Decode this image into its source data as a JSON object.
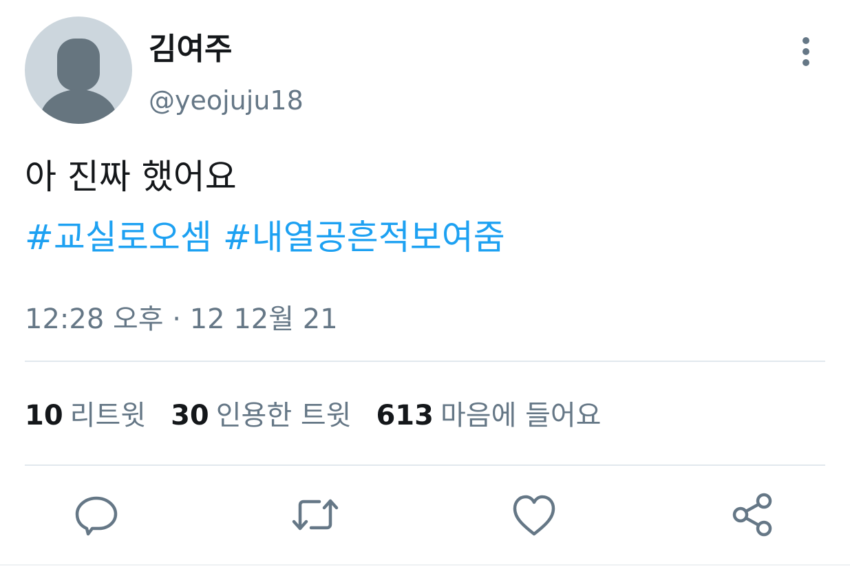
{
  "user": {
    "display_name": "김여주",
    "handle": "@yeojuju18"
  },
  "tweet": {
    "text": "아 진짜 했어요",
    "hashtags": [
      "#교실로오셈",
      "#내열공흔적보여줌"
    ],
    "timestamp": "12:28 오후 · 12 12월 21"
  },
  "stats": [
    {
      "count": "10",
      "label": "리트윗"
    },
    {
      "count": "30",
      "label": "인용한 트윗"
    },
    {
      "count": "613",
      "label": "마음에 들어요"
    }
  ],
  "actions": {
    "reply_icon": "reply-icon",
    "retweet_icon": "retweet-icon",
    "like_icon": "heart-icon",
    "share_icon": "share-icon",
    "more_icon": "more-vertical-icon"
  },
  "colors": {
    "link": "#1da1f2",
    "secondary_text": "#657786",
    "icon": "#657786",
    "avatar_bg": "#ccd6dd",
    "avatar_fg": "#66757f"
  }
}
